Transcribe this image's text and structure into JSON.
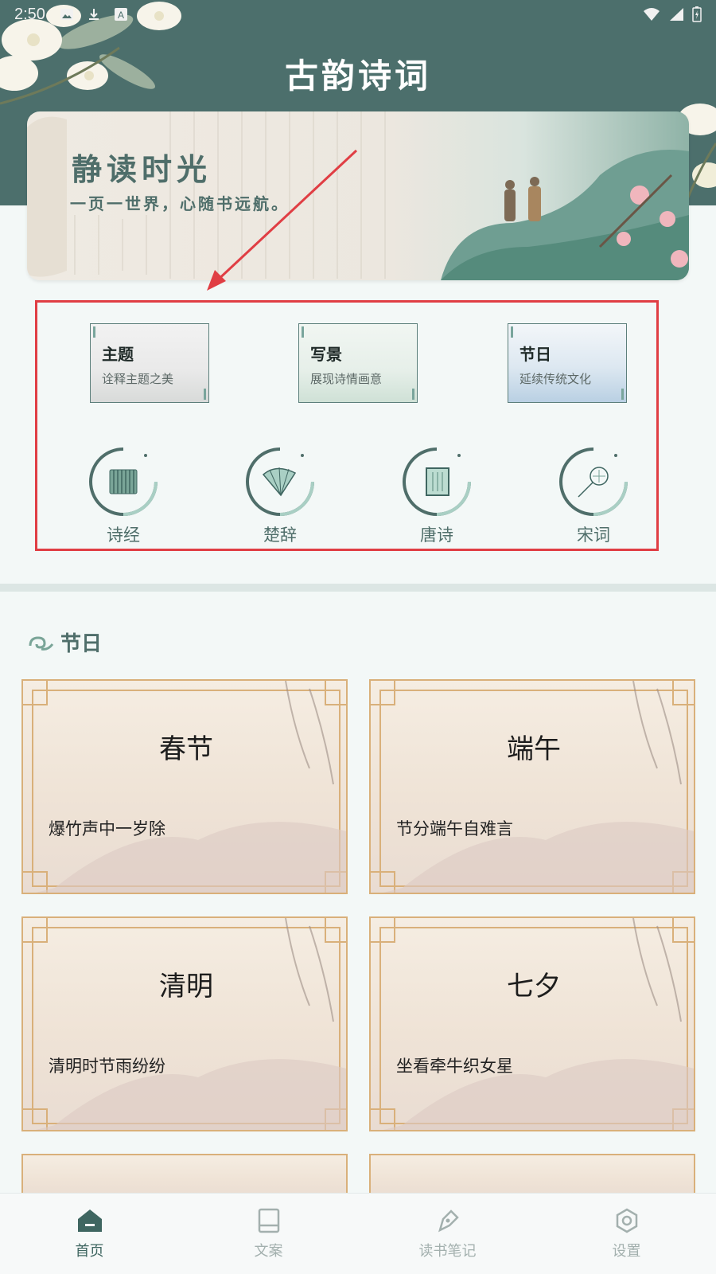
{
  "status_bar": {
    "time": "2:50"
  },
  "app": {
    "title": "古韵诗词"
  },
  "banner": {
    "title": "静读时光",
    "subtitle": "一页一世界，心随书远航。"
  },
  "categories": [
    {
      "title": "主题",
      "subtitle": "诠释主题之美"
    },
    {
      "title": "写景",
      "subtitle": "展现诗情画意"
    },
    {
      "title": "节日",
      "subtitle": "延续传统文化"
    }
  ],
  "dynasties": [
    {
      "label": "诗经",
      "icon": "bamboo-scroll-icon"
    },
    {
      "label": "楚辞",
      "icon": "folding-fan-icon"
    },
    {
      "label": "唐诗",
      "icon": "book-icon"
    },
    {
      "label": "宋词",
      "icon": "round-fan-icon"
    }
  ],
  "section": {
    "title": "节日"
  },
  "festivals": [
    {
      "name": "春节",
      "line": "爆竹声中一岁除"
    },
    {
      "name": "端午",
      "line": "节分端午自难言"
    },
    {
      "name": "清明",
      "line": "清明时节雨纷纷"
    },
    {
      "name": "七夕",
      "line": "坐看牵牛织女星"
    }
  ],
  "nav": [
    {
      "label": "首页",
      "icon": "home-icon",
      "active": true
    },
    {
      "label": "文案",
      "icon": "notebook-icon",
      "active": false
    },
    {
      "label": "读书笔记",
      "icon": "pen-icon",
      "active": false
    },
    {
      "label": "设置",
      "icon": "settings-icon",
      "active": false
    }
  ],
  "colors": {
    "header": "#4c6f6c",
    "accent": "#4f6e6a",
    "annotation": "#e03e44",
    "card_border": "#d9b07a"
  }
}
